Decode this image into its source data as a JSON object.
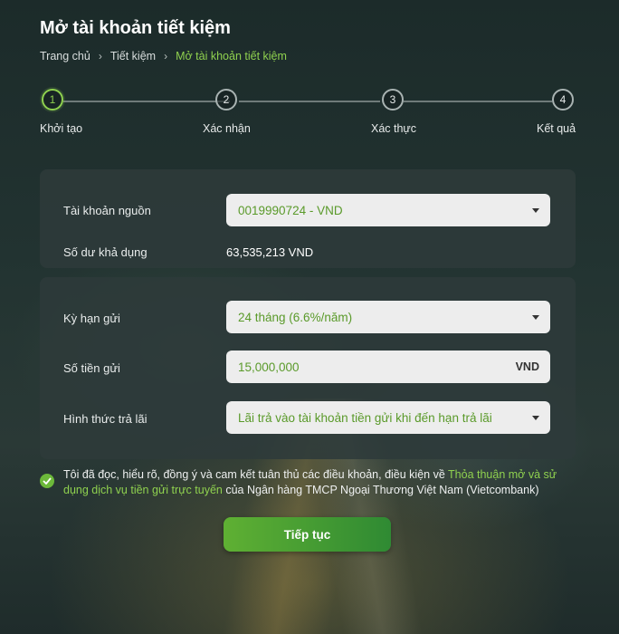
{
  "page": {
    "title": "Mở tài khoản tiết kiệm"
  },
  "breadcrumb": {
    "items": [
      "Trang chủ",
      "Tiết kiệm",
      "Mở tài khoản tiết kiệm"
    ],
    "separator": "›"
  },
  "stepper": {
    "active_step": 1,
    "steps": [
      {
        "number": "1",
        "label": "Khởi tạo"
      },
      {
        "number": "2",
        "label": "Xác nhận"
      },
      {
        "number": "3",
        "label": "Xác thực"
      },
      {
        "number": "4",
        "label": "Kết quả"
      }
    ]
  },
  "source_account": {
    "label": "Tài khoản nguồn",
    "value": "0019990724 - VND",
    "balance_label": "Số dư khả dụng",
    "balance_value": "63,535,213 VND"
  },
  "deposit": {
    "term_label": "Kỳ hạn gửi",
    "term_value": "24 tháng (6.6%/năm)",
    "amount_label": "Số tiền gửi",
    "amount_value": "15,000,000",
    "amount_unit": "VND",
    "interest_label": "Hình thức trả lãi",
    "interest_value": "Lãi trả vào tài khoản tiền gửi khi đến hạn trả lãi"
  },
  "agreement": {
    "checked": true,
    "text_before": "Tôi đã đọc, hiểu rõ, đồng ý và cam kết tuân thủ các điều khoản, điều kiện về ",
    "link_text": "Thỏa thuận mở và sử dụng dịch vụ tiền gửi trực tuyến",
    "text_after": " của Ngân hàng TMCP Ngoại Thương Việt Nam (Vietcombank)"
  },
  "actions": {
    "continue_label": "Tiếp tục"
  },
  "colors": {
    "accent": "#8fd14f",
    "button_start": "#5fb033",
    "button_end": "#2f8a33",
    "card_bg": "#2e3a3a"
  }
}
